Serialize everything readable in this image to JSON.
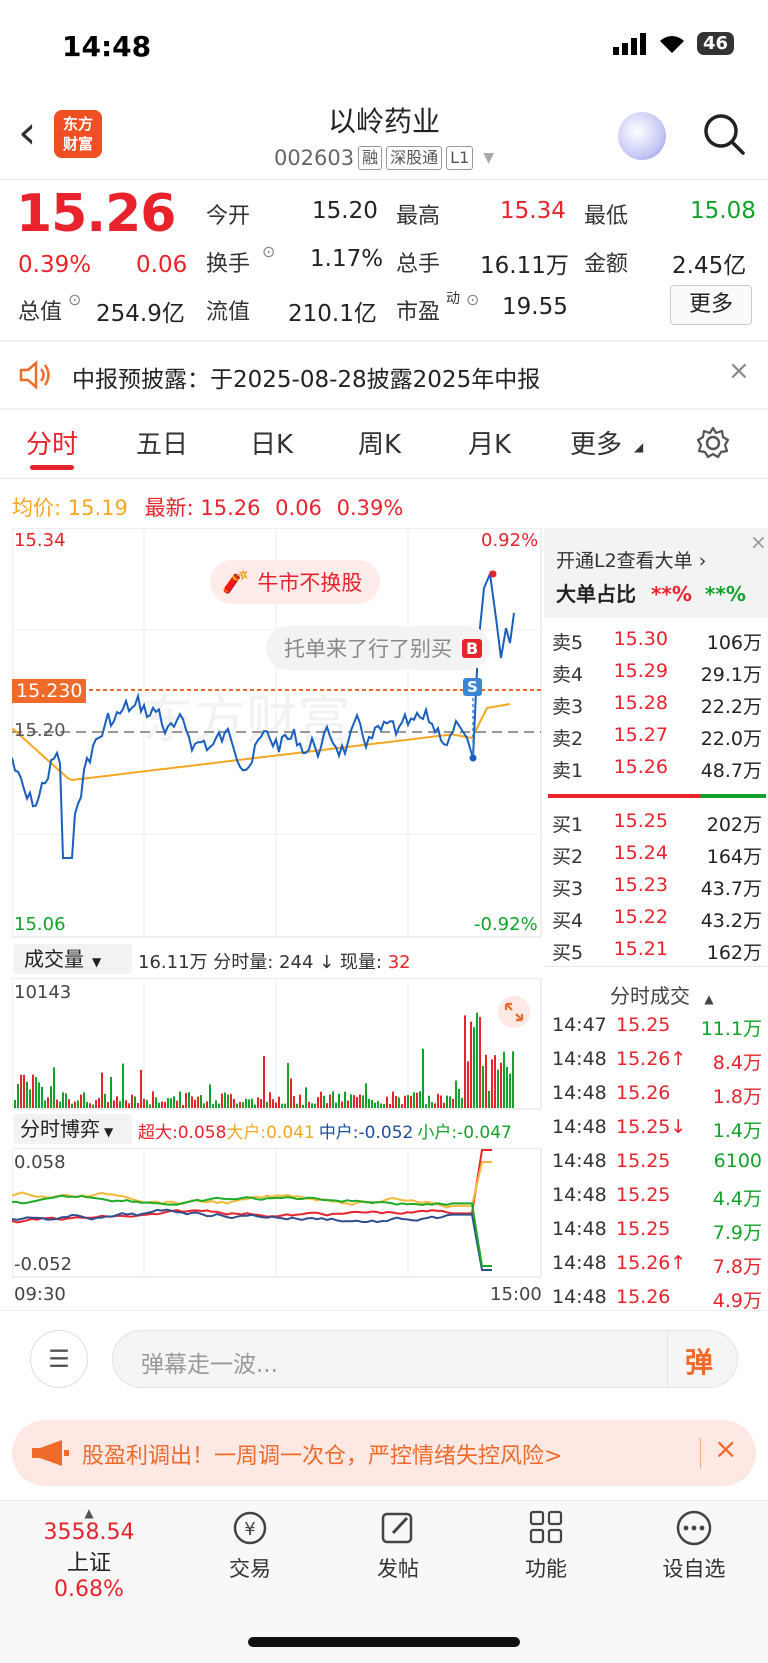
{
  "status": {
    "time": "14:48",
    "battery": "46"
  },
  "header": {
    "logo": "东方\n财富",
    "name": "以岭药业",
    "code": "002603",
    "tags": [
      "融",
      "深股通",
      "L1"
    ]
  },
  "quote": {
    "price": "15.26",
    "pct": "0.39%",
    "chg": "0.06",
    "open_label": "今开",
    "open": "15.20",
    "high_label": "最高",
    "high": "15.34",
    "low_label": "最低",
    "low": "15.08",
    "turnover_label": "换手",
    "turnover": "1.17%",
    "vol_label": "总手",
    "vol": "16.11万",
    "amount_label": "金额",
    "amount": "2.45亿",
    "mcap_label": "总值",
    "mcap": "254.9亿",
    "float_label": "流值",
    "float": "210.1亿",
    "pe_label": "市盈",
    "pe_sup": "动",
    "pe": "19.55",
    "more": "更多"
  },
  "notice": {
    "text": "中报预披露：于2025-08-28披露2025年中报"
  },
  "tabs": [
    "分时",
    "五日",
    "日K",
    "周K",
    "月K",
    "更多"
  ],
  "chart": {
    "avg_label": "均价:",
    "avg": "15.19",
    "latest_label": "最新:",
    "latest": "15.26",
    "latest_chg": "0.06",
    "latest_pct": "0.39%",
    "y_top": "15.34",
    "y_bottom": "15.06",
    "pct_top": "0.92%",
    "pct_bottom": "-0.92%",
    "ref_price": "15.230",
    "prev_close": "15.20",
    "bubble1": "牛市不换股",
    "bubble2": "托单来了行了别买",
    "marker_s": "S",
    "marker_b": "B",
    "watermark": "东方财富",
    "vol_selector": "成交量",
    "vol_info": "16.11万 分时量: 244 ↓ 现量:",
    "vol_now": "32",
    "vol_max": "10143",
    "game_selector": "分时博弈",
    "super_label": "超大:0.058",
    "big_label": "大户:0.041",
    "mid_label": "中户:-0.052",
    "small_label": "小户:-0.047",
    "game_top": "0.058",
    "game_bottom": "-0.052",
    "time_start": "09:30",
    "time_end": "15:00"
  },
  "orderbook": {
    "l2_link": "开通L2查看大单",
    "big_ratio_label": "大单占比",
    "big_ratio_red": "**%",
    "big_ratio_green": "**%",
    "asks": [
      {
        "label": "卖5",
        "price": "15.30",
        "vol": "106万"
      },
      {
        "label": "卖4",
        "price": "15.29",
        "vol": "29.1万"
      },
      {
        "label": "卖3",
        "price": "15.28",
        "vol": "22.2万"
      },
      {
        "label": "卖2",
        "price": "15.27",
        "vol": "22.0万"
      },
      {
        "label": "卖1",
        "price": "15.26",
        "vol": "48.7万"
      }
    ],
    "bids": [
      {
        "label": "买1",
        "price": "15.25",
        "vol": "202万"
      },
      {
        "label": "买2",
        "price": "15.24",
        "vol": "164万"
      },
      {
        "label": "买3",
        "price": "15.23",
        "vol": "43.7万"
      },
      {
        "label": "买4",
        "price": "15.22",
        "vol": "43.2万"
      },
      {
        "label": "买5",
        "price": "15.21",
        "vol": "162万"
      }
    ],
    "trades_title": "分时成交",
    "trades": [
      {
        "time": "14:47",
        "price": "15.25",
        "vol": "11.1万",
        "vol_color": "green"
      },
      {
        "time": "14:48",
        "price": "15.26↑",
        "vol": "8.4万",
        "vol_color": "red"
      },
      {
        "time": "14:48",
        "price": "15.26",
        "vol": "1.8万",
        "vol_color": "red"
      },
      {
        "time": "14:48",
        "price": "15.25↓",
        "vol": "1.4万",
        "vol_color": "green"
      },
      {
        "time": "14:48",
        "price": "15.25",
        "vol": "6100",
        "vol_color": "green"
      },
      {
        "time": "14:48",
        "price": "15.25",
        "vol": "4.4万",
        "vol_color": "green"
      },
      {
        "time": "14:48",
        "price": "15.25",
        "vol": "7.9万",
        "vol_color": "green"
      },
      {
        "time": "14:48",
        "price": "15.26↑",
        "vol": "7.8万",
        "vol_color": "red"
      },
      {
        "time": "14:48",
        "price": "15.26",
        "vol": "4.9万",
        "vol_color": "red"
      }
    ]
  },
  "comment": {
    "placeholder": "弹幕走一波...",
    "danmu_btn": "弹"
  },
  "ad": {
    "text": "股盈利调出！一周调一次仓，严控情绪失控风险>"
  },
  "tabbar": {
    "index_value": "3558.54",
    "index_name": "上证",
    "index_pct": "0.68%",
    "items": [
      "交易",
      "发帖",
      "功能",
      "设自选"
    ]
  },
  "colors": {
    "accent": "#e8232c",
    "down": "#12a22a",
    "avg_line": "#f5a623",
    "price_line": "#1a5fbd"
  }
}
